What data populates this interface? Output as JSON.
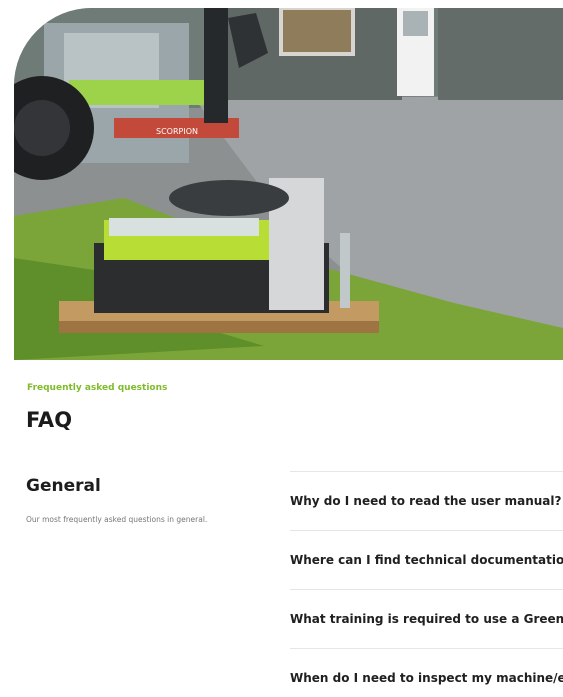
{
  "hero": {
    "image_alt": "Flail mower attachment on a wooden pallet in front of a tractor",
    "logo_text": "SCORPION"
  },
  "faq": {
    "eyebrow": "Frequently asked questions",
    "title": "FAQ",
    "category": {
      "title": "General",
      "description": "Our most frequently asked questions in general."
    },
    "questions": [
      "Why do I need to read the user manual?",
      "Where can I find technical documentation f",
      "What training is required to use a Greentec",
      "When do I need to inspect my machine/equ"
    ]
  },
  "colors": {
    "accent": "#7fbc2a",
    "machine_green": "#b8dd35"
  }
}
